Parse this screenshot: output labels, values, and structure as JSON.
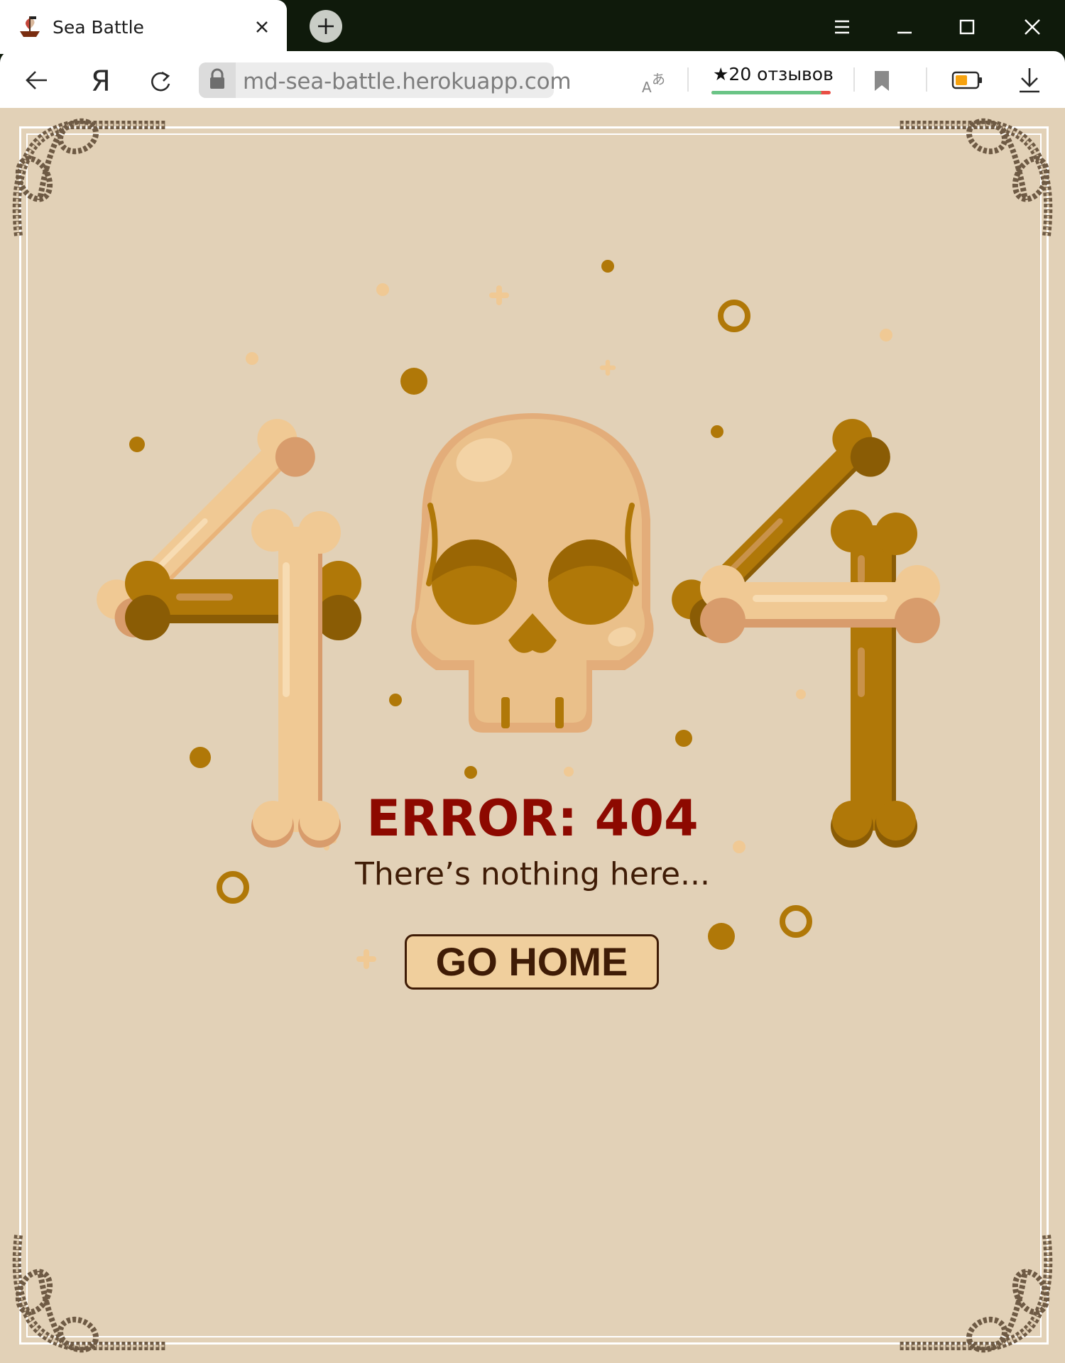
{
  "browser": {
    "tab": {
      "title": "Sea Battle",
      "favicon": "pirate-ship-icon"
    },
    "address_bar": {
      "url": "md-sea-battle.herokuapp.com"
    },
    "reviews": {
      "label": "★20 отзывов",
      "positive_fraction": 0.92
    },
    "icons": [
      "back-arrow-icon",
      "yandex-logo-icon",
      "reload-icon",
      "lock-icon",
      "translate-icon",
      "bookmark-icon",
      "battery-icon",
      "download-icon",
      "menu-icon",
      "minimize-icon",
      "maximize-icon",
      "close-window-icon"
    ]
  },
  "page": {
    "error_title": "ERROR: 404",
    "error_message": "There’s nothing here...",
    "home_button": "GO HOME"
  },
  "colors": {
    "background": "#e2d1b7",
    "bone_light": "#f0c994",
    "bone_dark": "#b07808",
    "error_title": "#8d0900",
    "text_dark": "#3f1c06"
  }
}
